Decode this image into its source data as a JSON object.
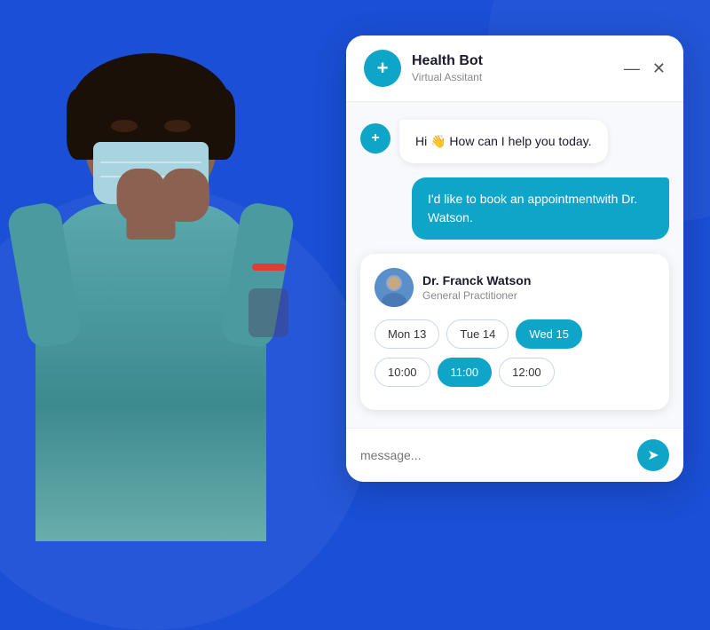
{
  "background_color": "#1a4fd6",
  "chat": {
    "header": {
      "title": "Health Bot",
      "subtitle": "Virtual Assitant",
      "icon_symbol": "+",
      "minimize_label": "—",
      "close_label": "✕"
    },
    "messages": [
      {
        "type": "bot",
        "text": "Hi 👋 How can I help you today."
      },
      {
        "type": "user",
        "text": "I'd like to book an appointmentwith Dr. Watson."
      }
    ],
    "doctor_card": {
      "name": "Dr. Franck Watson",
      "specialty": "General Practitioner",
      "date_slots": [
        {
          "label": "Mon 13",
          "active": false
        },
        {
          "label": "Tue 14",
          "active": false
        },
        {
          "label": "Wed 15",
          "active": true
        }
      ],
      "time_slots": [
        {
          "label": "10:00",
          "active": false
        },
        {
          "label": "11:00",
          "active": true
        },
        {
          "label": "12:00",
          "active": false
        }
      ]
    },
    "input": {
      "placeholder": "message...",
      "send_icon": "➤"
    }
  }
}
